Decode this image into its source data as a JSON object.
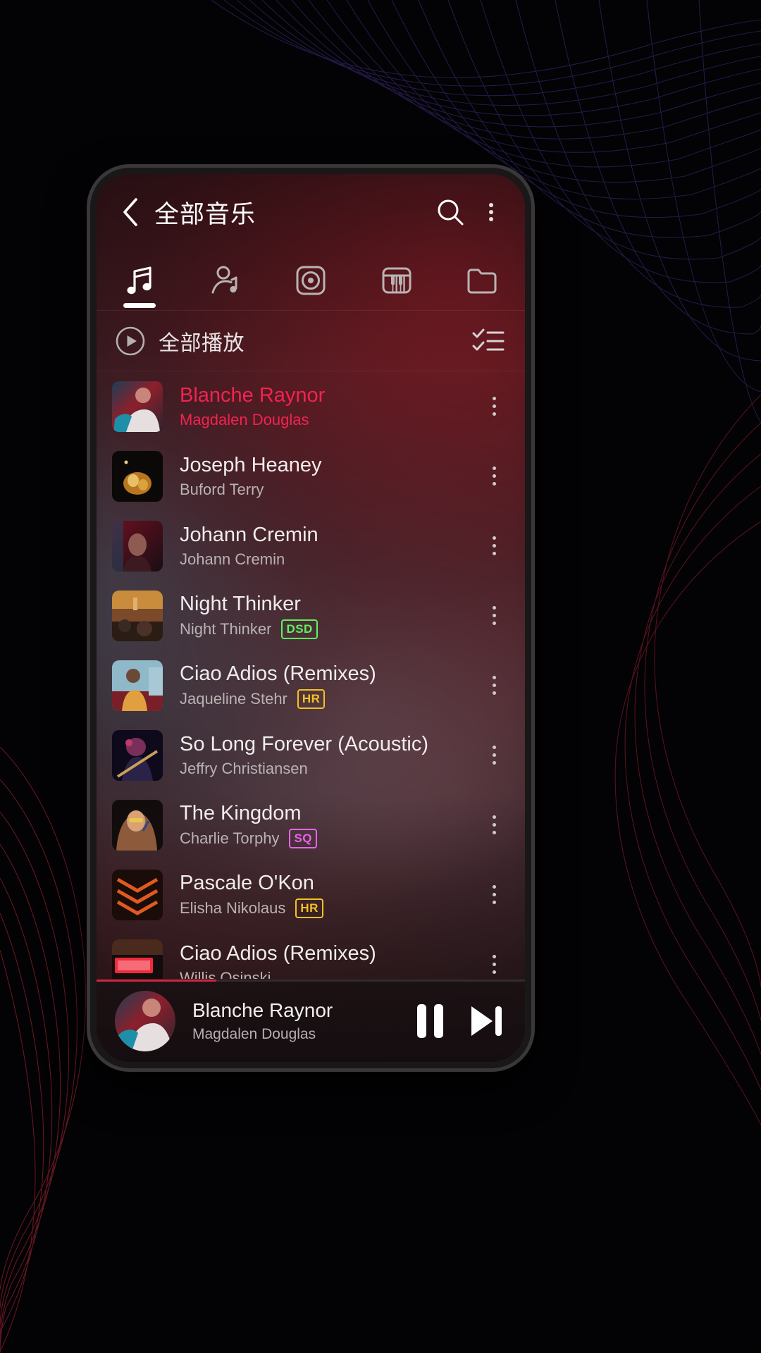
{
  "appbar": {
    "back_icon": "chevron-left-icon",
    "title": "全部音乐",
    "search_icon": "search-icon",
    "overflow_icon": "more-vertical-icon"
  },
  "tabs": [
    {
      "id": "songs",
      "icon": "music-note-icon",
      "active": true
    },
    {
      "id": "artists",
      "icon": "artist-icon",
      "active": false
    },
    {
      "id": "albums",
      "icon": "album-disc-icon",
      "active": false
    },
    {
      "id": "genres",
      "icon": "piano-keys-icon",
      "active": false
    },
    {
      "id": "folders",
      "icon": "folder-icon",
      "active": false
    }
  ],
  "playall": {
    "play_icon": "play-circle-icon",
    "label": "全部播放",
    "multiselect_icon": "checklist-icon"
  },
  "songs": [
    {
      "title": "Blanche Raynor",
      "artist": "Magdalen Douglas",
      "badge": "",
      "active": true,
      "more_icon": "more-vertical-icon"
    },
    {
      "title": "Joseph Heaney",
      "artist": "Buford Terry",
      "badge": "",
      "active": false,
      "more_icon": "more-vertical-icon"
    },
    {
      "title": "Johann Cremin",
      "artist": "Johann Cremin",
      "badge": "",
      "active": false,
      "more_icon": "more-vertical-icon"
    },
    {
      "title": "Night Thinker",
      "artist": "Night Thinker",
      "badge": "DSD",
      "active": false,
      "more_icon": "more-vertical-icon"
    },
    {
      "title": "Ciao Adios (Remixes)",
      "artist": "Jaqueline Stehr",
      "badge": "HR",
      "active": false,
      "more_icon": "more-vertical-icon"
    },
    {
      "title": "So Long Forever (Acoustic)",
      "artist": "Jeffry Christiansen",
      "badge": "",
      "active": false,
      "more_icon": "more-vertical-icon"
    },
    {
      "title": "The Kingdom",
      "artist": "Charlie Torphy",
      "badge": "SQ",
      "active": false,
      "more_icon": "more-vertical-icon"
    },
    {
      "title": "Pascale O'Kon",
      "artist": "Elisha Nikolaus",
      "badge": "HR",
      "active": false,
      "more_icon": "more-vertical-icon"
    },
    {
      "title": "Ciao Adios (Remixes)",
      "artist": "Willis Osinski",
      "badge": "",
      "active": false,
      "more_icon": "more-vertical-icon"
    }
  ],
  "miniplayer": {
    "title": "Blanche Raynor",
    "artist": "Magdalen Douglas",
    "pause_icon": "pause-icon",
    "next_icon": "skip-next-icon",
    "progress_percent": 28
  },
  "colors": {
    "accent_pink": "#f2234f",
    "badge_dsd": "#5df45d",
    "badge_hr": "#f3c220",
    "badge_sq": "#e863f0",
    "progress": "#d3253f"
  }
}
